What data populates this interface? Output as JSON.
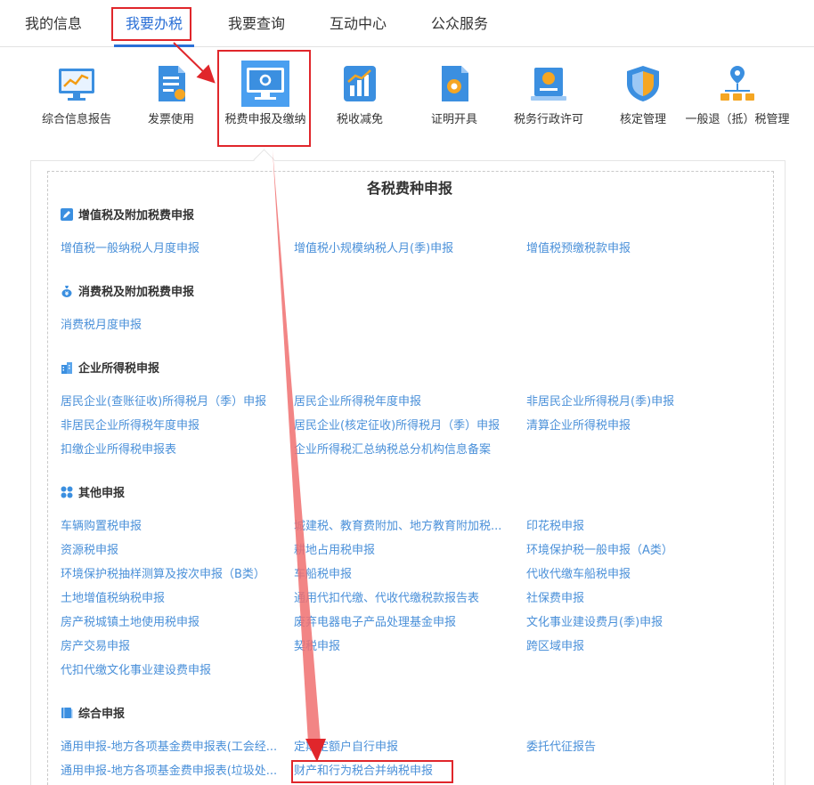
{
  "nav": {
    "tabs": [
      {
        "label": "我的信息"
      },
      {
        "label": "我要办税"
      },
      {
        "label": "我要查询"
      },
      {
        "label": "互动中心"
      },
      {
        "label": "公众服务"
      }
    ]
  },
  "functions": [
    {
      "label": "综合信息报告",
      "icon": "monitor-chart-icon"
    },
    {
      "label": "发票使用",
      "icon": "invoice-icon"
    },
    {
      "label": "税费申报及缴纳",
      "icon": "monitor-refresh-icon"
    },
    {
      "label": "税收减免",
      "icon": "chart-box-icon"
    },
    {
      "label": "证明开具",
      "icon": "certificate-icon"
    },
    {
      "label": "税务行政许可",
      "icon": "permit-icon"
    },
    {
      "label": "核定管理",
      "icon": "shield-icon"
    },
    {
      "label": "一般退（抵）税管理",
      "icon": "network-pin-icon"
    }
  ],
  "panel": {
    "title": "各税费种申报",
    "sections": [
      {
        "title": "增值税及附加税费申报",
        "icon": "edit-icon",
        "links": [
          "增值税一般纳税人月度申报",
          "增值税小规模纳税人月(季)申报",
          "增值税预缴税款申报"
        ]
      },
      {
        "title": "消费税及附加税费申报",
        "icon": "money-bag-icon",
        "links": [
          "消费税月度申报"
        ]
      },
      {
        "title": "企业所得税申报",
        "icon": "building-icon",
        "links": [
          "居民企业(查账征收)所得税月（季）申报",
          "居民企业所得税年度申报",
          "非居民企业所得税月(季)申报",
          "非居民企业所得税年度申报",
          "居民企业(核定征收)所得税月（季）申报",
          "清算企业所得税申报",
          "扣缴企业所得税申报表",
          "企业所得税汇总纳税总分机构信息备案"
        ]
      },
      {
        "title": "其他申报",
        "icon": "grid-icon",
        "links": [
          "车辆购置税申报",
          "城建税、教育费附加、地方教育附加税...",
          "印花税申报",
          "资源税申报",
          "耕地占用税申报",
          "环境保护税一般申报（A类）",
          "环境保护税抽样测算及按次申报（B类）",
          "车船税申报",
          "代收代缴车船税申报",
          "土地增值税纳税申报",
          "通用代扣代缴、代收代缴税款报告表",
          "社保费申报",
          "房产税城镇土地使用税申报",
          "废弃电器电子产品处理基金申报",
          "文化事业建设费月(季)申报",
          "房产交易申报",
          "契税申报",
          "跨区域申报",
          "代扣代缴文化事业建设费申报"
        ]
      },
      {
        "title": "综合申报",
        "icon": "book-icon",
        "links": [
          "通用申报-地方各项基金费申报表(工会经...",
          "定期定额户自行申报",
          "委托代征报告",
          "通用申报-地方各项基金费申报表(垃圾处...",
          "财产和行为税合并纳税申报"
        ]
      }
    ]
  },
  "colors": {
    "accent": "#2a6fd6",
    "link": "#4a90d9",
    "highlight": "#e0262b"
  }
}
